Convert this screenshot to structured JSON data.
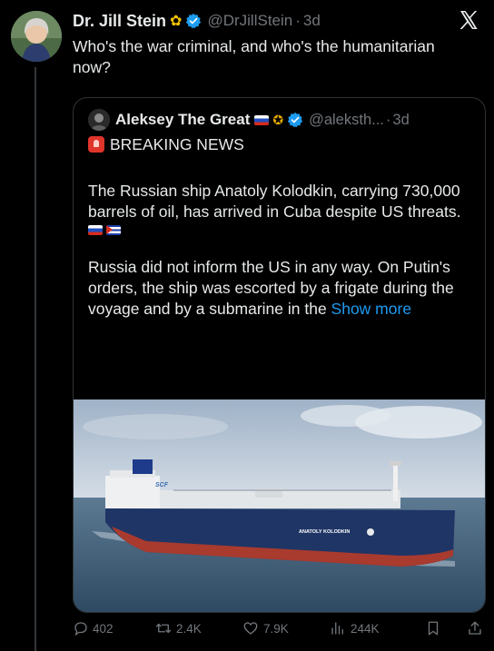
{
  "tweet": {
    "author_name": "Dr. Jill Stein",
    "author_handle": "@DrJillStein",
    "time": "3d",
    "name_emoji": "sunflower",
    "text": "Who's the war criminal, and who's the humanitarian now?"
  },
  "quote": {
    "author_name": "Aleksey The Great",
    "author_handle": "@aleksth...",
    "time": "3d",
    "breaking_label": "BREAKING NEWS",
    "paragraph1": "The Russian ship Anatoly Kolodkin, carrying 730,000 barrels of oil, has arrived in Cuba despite US threats.",
    "paragraph2_text": "Russia did not inform the US in any way. On Putin's orders, the ship was escorted by a frigate during the voyage and by a submarine in the",
    "show_more": "Show more",
    "image": {
      "ship_hull_text": "ANATOLY KOLODKIN",
      "funnel_text": "SCF"
    }
  },
  "actions": {
    "replies": "402",
    "reposts": "2.4K",
    "likes": "7.9K",
    "views": "244K"
  },
  "icons": {
    "verified": "verified-badge-icon",
    "x_logo": "x-logo-icon",
    "reply": "reply-icon",
    "repost": "repost-icon",
    "like": "heart-icon",
    "views": "views-icon",
    "bookmark": "bookmark-icon",
    "share": "share-icon"
  },
  "colors": {
    "background": "#000000",
    "text": "#e7e9ea",
    "secondary": "#71767b",
    "link": "#1d9bf0",
    "verified": "#1d9bf0"
  }
}
